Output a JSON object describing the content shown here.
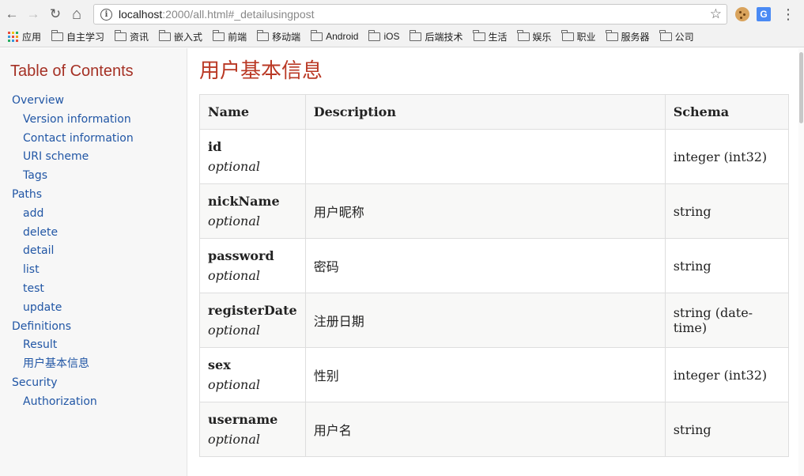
{
  "browser": {
    "url_host": "localhost",
    "url_rest": ":2000/all.html#_detailusingpost",
    "bookmarks": [
      {
        "label": "应用",
        "icon": "apps-grid-icon"
      },
      {
        "label": "自主学习",
        "icon": "folder-icon"
      },
      {
        "label": "资讯",
        "icon": "folder-icon"
      },
      {
        "label": "嵌入式",
        "icon": "folder-icon"
      },
      {
        "label": "前端",
        "icon": "folder-icon"
      },
      {
        "label": "移动端",
        "icon": "folder-icon"
      },
      {
        "label": "Android",
        "icon": "folder-icon"
      },
      {
        "label": "iOS",
        "icon": "folder-icon"
      },
      {
        "label": "后端技术",
        "icon": "folder-icon"
      },
      {
        "label": "生活",
        "icon": "folder-icon"
      },
      {
        "label": "娱乐",
        "icon": "folder-icon"
      },
      {
        "label": "职业",
        "icon": "folder-icon"
      },
      {
        "label": "服务器",
        "icon": "folder-icon"
      },
      {
        "label": "公司",
        "icon": "folder-icon"
      }
    ],
    "icons": {
      "back": "←",
      "forward": "→",
      "reload": "↻",
      "home": "⌂",
      "info": "i",
      "star": "☆",
      "translate": "G",
      "menu": "⋮"
    }
  },
  "sidebar": {
    "title": "Table of Contents",
    "items": [
      {
        "label": "Overview",
        "level": 1
      },
      {
        "label": "Version information",
        "level": 2
      },
      {
        "label": "Contact information",
        "level": 2
      },
      {
        "label": "URI scheme",
        "level": 2
      },
      {
        "label": "Tags",
        "level": 2
      },
      {
        "label": "Paths",
        "level": 1
      },
      {
        "label": "add",
        "level": 2
      },
      {
        "label": "delete",
        "level": 2
      },
      {
        "label": "detail",
        "level": 2
      },
      {
        "label": "list",
        "level": 2
      },
      {
        "label": "test",
        "level": 2
      },
      {
        "label": "update",
        "level": 2
      },
      {
        "label": "Definitions",
        "level": 1
      },
      {
        "label": "Result",
        "level": 2
      },
      {
        "label": "用户基本信息",
        "level": 2
      },
      {
        "label": "Security",
        "level": 1
      },
      {
        "label": "Authorization",
        "level": 2
      }
    ]
  },
  "main": {
    "title": "用户基本信息",
    "table": {
      "headers": [
        "Name",
        "Description",
        "Schema"
      ],
      "rows": [
        {
          "name": "id",
          "optional": "optional",
          "description": "",
          "schema": "integer (int32)"
        },
        {
          "name": "nickName",
          "optional": "optional",
          "description": "用户昵称",
          "schema": "string"
        },
        {
          "name": "password",
          "optional": "optional",
          "description": "密码",
          "schema": "string"
        },
        {
          "name": "registerDate",
          "optional": "optional",
          "description": "注册日期",
          "schema": "string (date-time)"
        },
        {
          "name": "sex",
          "optional": "optional",
          "description": "性别",
          "schema": "integer (int32)"
        },
        {
          "name": "username",
          "optional": "optional",
          "description": "用户名",
          "schema": "string"
        }
      ]
    }
  },
  "colors": {
    "toc_title": "#a53125",
    "link": "#2156a5",
    "section_title": "#ba3925"
  }
}
